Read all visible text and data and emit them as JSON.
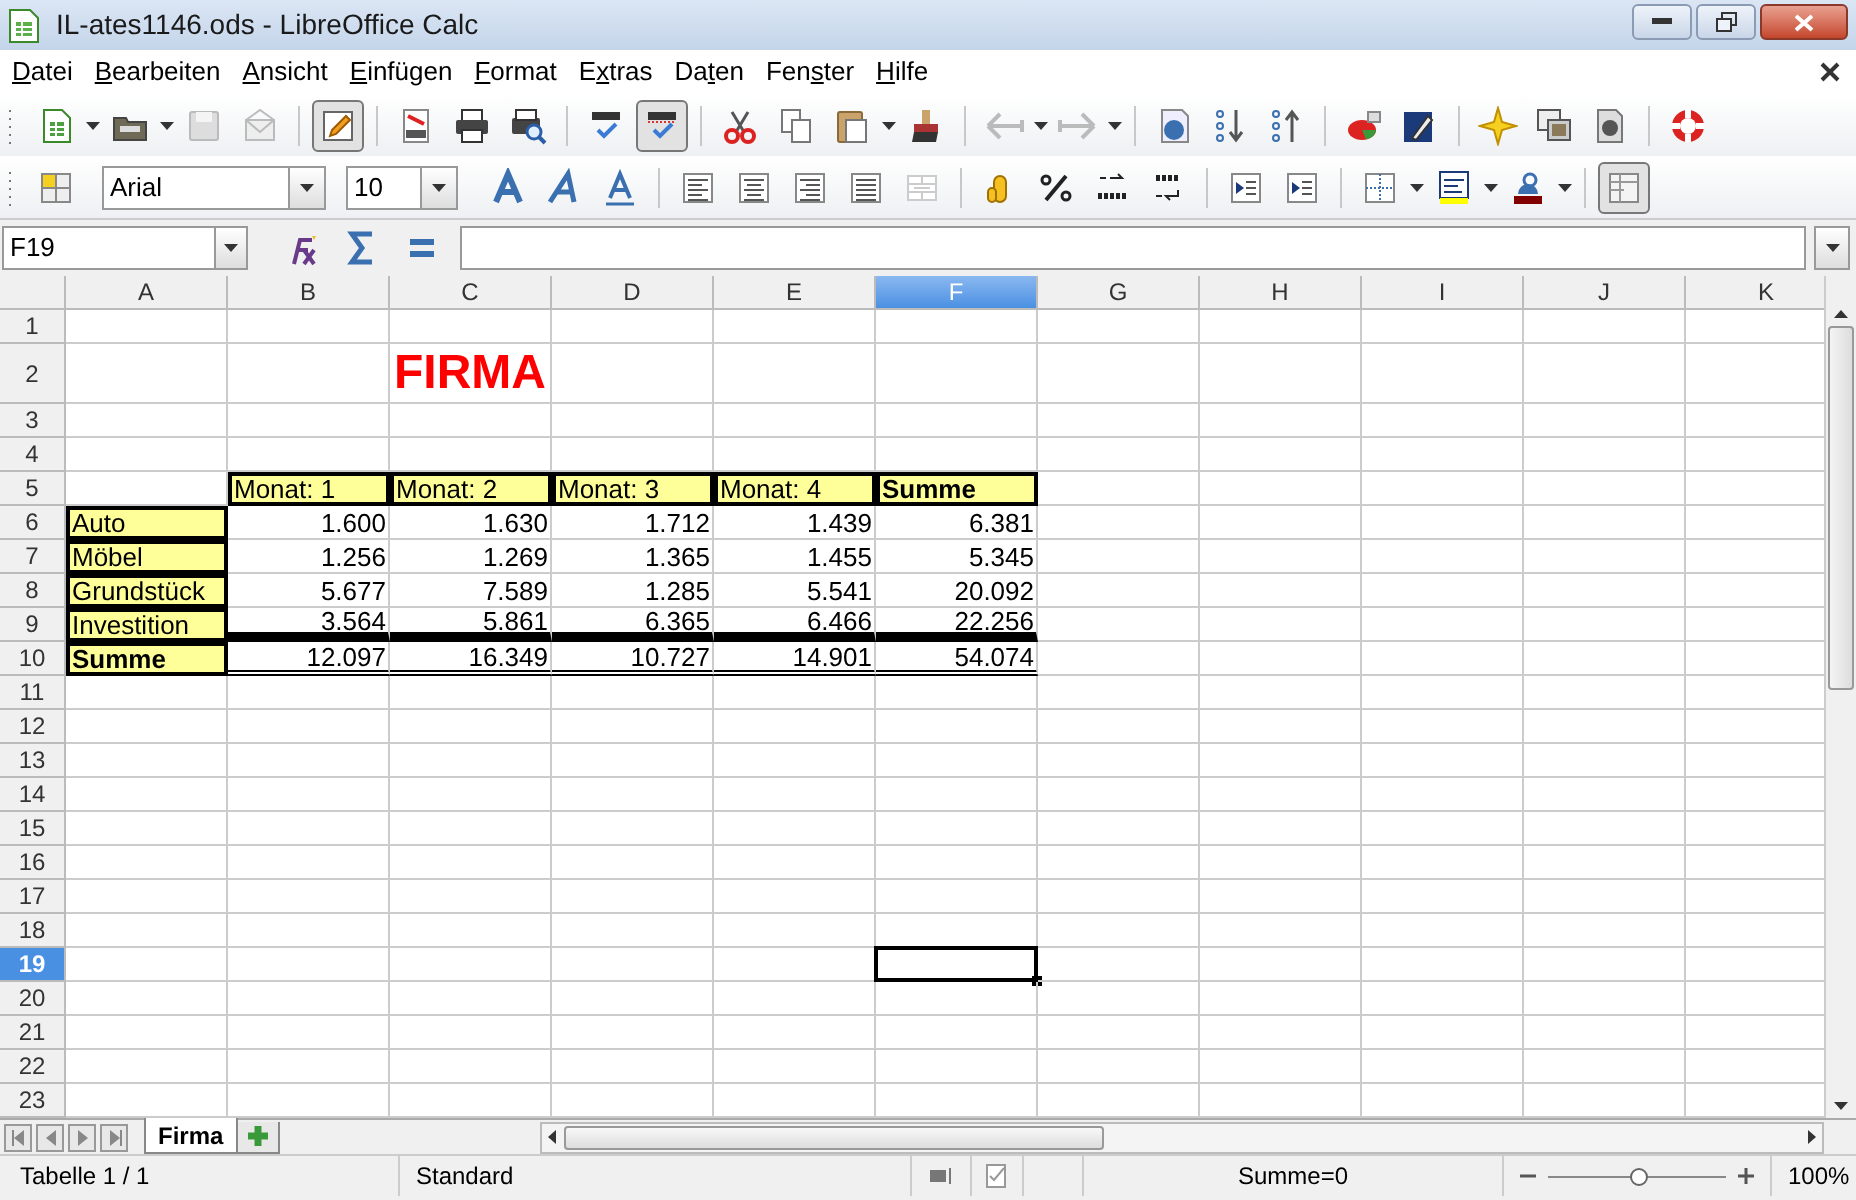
{
  "window": {
    "title": "IL-ates1146.ods - LibreOffice Calc"
  },
  "menu": [
    {
      "key": "D",
      "after": "atei"
    },
    {
      "key": "B",
      "after": "earbeiten"
    },
    {
      "key": "A",
      "after": "nsicht"
    },
    {
      "key": "E",
      "after": "infügen"
    },
    {
      "key": "F",
      "after": "ormat"
    },
    {
      "before": "E",
      "key": "x",
      "after": "tras"
    },
    {
      "before": "Da",
      "key": "t",
      "after": "en"
    },
    {
      "before": "Fen",
      "key": "s",
      "after": "ter"
    },
    {
      "key": "H",
      "after": "ilfe"
    }
  ],
  "formatting": {
    "font_name": "Arial",
    "font_size": "10"
  },
  "formula_bar": {
    "name_box": "F19"
  },
  "columns": [
    {
      "label": "A",
      "selected": false
    },
    {
      "label": "B",
      "selected": false
    },
    {
      "label": "C",
      "selected": false
    },
    {
      "label": "D",
      "selected": false
    },
    {
      "label": "E",
      "selected": false
    },
    {
      "label": "F",
      "selected": true
    },
    {
      "label": "G",
      "selected": false
    },
    {
      "label": "H",
      "selected": false
    },
    {
      "label": "I",
      "selected": false
    },
    {
      "label": "J",
      "selected": false
    },
    {
      "label": "K",
      "selected": false
    }
  ],
  "rows": [
    {
      "label": "1",
      "selected": false
    },
    {
      "label": "2",
      "selected": false,
      "cells": [
        null,
        null,
        {
          "kind": "title",
          "text": "FIRMA",
          "bold": true
        },
        null,
        null,
        null
      ]
    },
    {
      "label": "3",
      "selected": false
    },
    {
      "label": "4",
      "selected": false
    },
    {
      "label": "5",
      "selected": false,
      "cells": [
        null,
        {
          "kind": "header",
          "text": "Monat: 1",
          "bold": false
        },
        {
          "kind": "header",
          "text": "Monat: 2",
          "bold": false
        },
        {
          "kind": "header",
          "text": "Monat: 3",
          "bold": false
        },
        {
          "kind": "header",
          "text": "Monat: 4",
          "bold": false
        },
        {
          "kind": "header",
          "text": "Summe",
          "bold": true
        }
      ]
    },
    {
      "label": "6",
      "selected": false,
      "cells": [
        {
          "kind": "label",
          "text": "Auto",
          "bold": false
        },
        {
          "kind": "number",
          "text": "1.600"
        },
        {
          "kind": "number",
          "text": "1.630"
        },
        {
          "kind": "number",
          "text": "1.712"
        },
        {
          "kind": "number",
          "text": "1.439"
        },
        {
          "kind": "number",
          "text": "6.381"
        }
      ]
    },
    {
      "label": "7",
      "selected": false,
      "cells": [
        {
          "kind": "label",
          "text": "Möbel",
          "bold": false
        },
        {
          "kind": "number",
          "text": "1.256"
        },
        {
          "kind": "number",
          "text": "1.269"
        },
        {
          "kind": "number",
          "text": "1.365"
        },
        {
          "kind": "number",
          "text": "1.455"
        },
        {
          "kind": "number",
          "text": "5.345"
        }
      ]
    },
    {
      "label": "8",
      "selected": false,
      "cells": [
        {
          "kind": "label",
          "text": "Grundstück",
          "bold": false
        },
        {
          "kind": "number",
          "text": "5.677"
        },
        {
          "kind": "number",
          "text": "7.589"
        },
        {
          "kind": "number",
          "text": "1.285"
        },
        {
          "kind": "number",
          "text": "5.541"
        },
        {
          "kind": "number",
          "text": "20.092"
        }
      ]
    },
    {
      "label": "9",
      "selected": false,
      "rule_thick": true,
      "cells": [
        {
          "kind": "label",
          "text": "Investition",
          "bold": false
        },
        {
          "kind": "number",
          "text": "3.564"
        },
        {
          "kind": "number",
          "text": "5.861"
        },
        {
          "kind": "number",
          "text": "6.365"
        },
        {
          "kind": "number",
          "text": "6.466"
        },
        {
          "kind": "number",
          "text": "22.256"
        }
      ]
    },
    {
      "label": "10",
      "selected": false,
      "rule_double": true,
      "cells": [
        {
          "kind": "label",
          "text": "Summe",
          "bold": true
        },
        {
          "kind": "number",
          "text": "12.097"
        },
        {
          "kind": "number",
          "text": "16.349"
        },
        {
          "kind": "number",
          "text": "10.727"
        },
        {
          "kind": "number",
          "text": "14.901"
        },
        {
          "kind": "number",
          "text": "54.074"
        }
      ]
    },
    {
      "label": "11",
      "selected": false
    },
    {
      "label": "12",
      "selected": false
    },
    {
      "label": "13",
      "selected": false
    },
    {
      "label": "14",
      "selected": false
    },
    {
      "label": "15",
      "selected": false
    },
    {
      "label": "16",
      "selected": false
    },
    {
      "label": "17",
      "selected": false
    },
    {
      "label": "18",
      "selected": false
    },
    {
      "label": "19",
      "selected": true
    },
    {
      "label": "20",
      "selected": false
    },
    {
      "label": "21",
      "selected": false
    },
    {
      "label": "22",
      "selected": false
    },
    {
      "label": "23",
      "selected": false
    }
  ],
  "sheet_tabs": [
    {
      "label": "Firma",
      "selected": true
    }
  ],
  "status_bar": {
    "sheet": "Tabelle 1 / 1",
    "style": "Standard",
    "sum": "Summe=0",
    "zoom": "100%",
    "zoom_slider": {
      "level": 0.5
    }
  }
}
